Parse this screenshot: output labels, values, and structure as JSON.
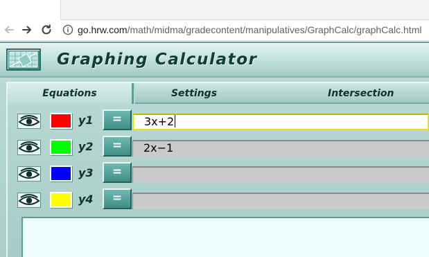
{
  "browser": {
    "back_icon": "arrow-left-icon",
    "forward_icon": "arrow-right-icon",
    "reload_icon": "reload-icon",
    "info_icon": "info-circle-icon",
    "url_host": "go.hrw.com",
    "url_path": "/math/midma/gradecontent/manipulatives/GraphCalc/graphCalc.html"
  },
  "app": {
    "title": "Graphing Calculator",
    "logo_icon": "calculator-graph-logo",
    "tabs": [
      {
        "label": "Equations",
        "selected": true
      },
      {
        "label": "Settings",
        "selected": false
      },
      {
        "label": "Intersection",
        "selected": false
      }
    ],
    "equations": [
      {
        "name": "y1",
        "color": "#ff0000",
        "button": "=",
        "value": "3x+2",
        "active": true
      },
      {
        "name": "y2",
        "color": "#00ff00",
        "button": "=",
        "value": "2x−1",
        "active": false
      },
      {
        "name": "y3",
        "color": "#0000ff",
        "button": "=",
        "value": "",
        "active": false
      },
      {
        "name": "y4",
        "color": "#ffff00",
        "button": "=",
        "value": "",
        "active": false
      }
    ],
    "eye_icon": "eye-icon"
  },
  "colors": {
    "accent": "#3f8f87",
    "title_text": "#0f3e38",
    "panel": "#b9d9d4"
  }
}
